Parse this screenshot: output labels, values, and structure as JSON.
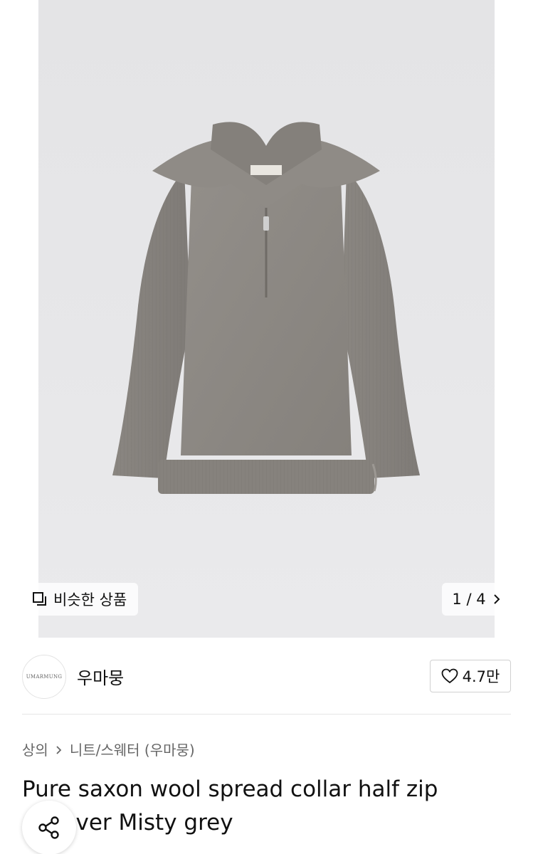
{
  "gallery": {
    "image_alt": "Grey half zip wool pullover with spread collar",
    "similar_label": "비슷한 상품",
    "pager": {
      "current": "1",
      "total": "4",
      "text": "1 / 4"
    },
    "icons": {
      "similar": "similar-items-icon",
      "next": "chevron-right-icon"
    }
  },
  "shop": {
    "avatar_text": "UMARMUNG",
    "name": "우마뭉",
    "likes": "4.7만",
    "icons": {
      "like": "heart-icon"
    }
  },
  "breadcrumb": {
    "items": [
      "상의",
      "니트/스웨터 (우마뭉)"
    ]
  },
  "product": {
    "title": "Pure saxon wool spread collar half zip pullover Misty grey"
  },
  "share": {
    "icon": "share-icon"
  },
  "colors": {
    "background": "#ffffff",
    "photo_bg": "#e6e6e8",
    "sweater": "#8c8883",
    "text_primary": "#111111",
    "text_secondary": "#666666",
    "border": "#d0d0d0"
  }
}
